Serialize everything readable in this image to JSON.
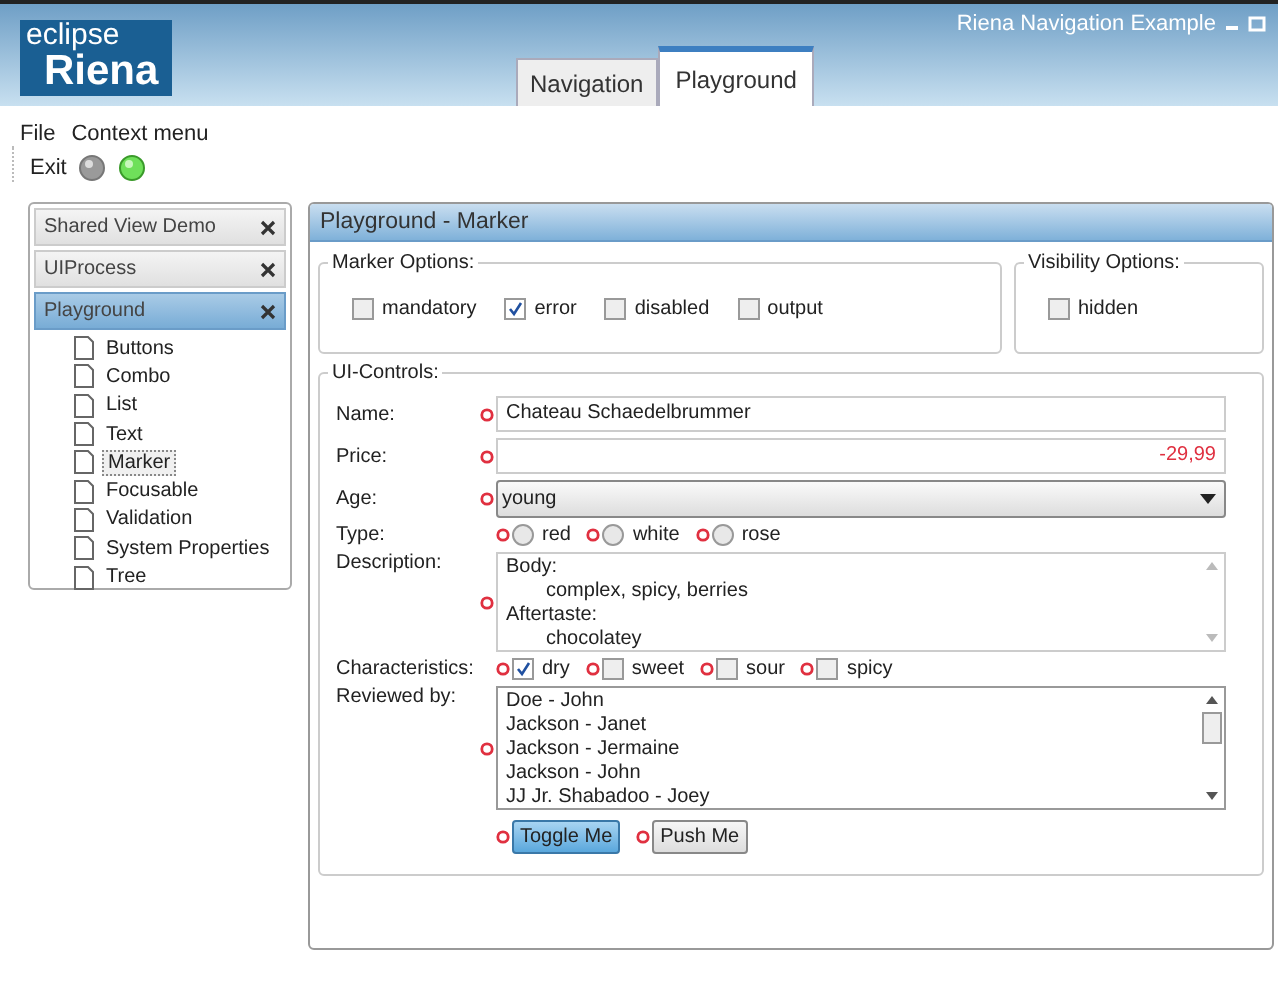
{
  "window": {
    "title": "Riena Navigation Example"
  },
  "logo": {
    "top": "eclipse",
    "bottom": "Riena"
  },
  "tabs": [
    {
      "label": "Navigation",
      "selected": false
    },
    {
      "label": "Playground",
      "selected": true
    }
  ],
  "menu": [
    "File",
    "Context menu"
  ],
  "toolbar": {
    "exit": "Exit"
  },
  "sidebar": {
    "groups": [
      {
        "label": "Shared View Demo",
        "selected": false
      },
      {
        "label": "UIProcess",
        "selected": false
      },
      {
        "label": "Playground",
        "selected": true,
        "children": [
          {
            "label": "Buttons",
            "selected": false
          },
          {
            "label": "Combo",
            "selected": false
          },
          {
            "label": "List",
            "selected": false
          },
          {
            "label": "Text",
            "selected": false
          },
          {
            "label": "Marker",
            "selected": true
          },
          {
            "label": "Focusable",
            "selected": false
          },
          {
            "label": "Validation",
            "selected": false
          },
          {
            "label": "System Properties",
            "selected": false
          },
          {
            "label": "Tree",
            "selected": false
          }
        ]
      }
    ]
  },
  "view": {
    "title": "Playground - Marker",
    "marker_options": {
      "title": "Marker Options:",
      "options": [
        {
          "label": "mandatory",
          "checked": false
        },
        {
          "label": "error",
          "checked": true
        },
        {
          "label": "disabled",
          "checked": false
        },
        {
          "label": "output",
          "checked": false
        }
      ]
    },
    "visibility_options": {
      "title": "Visibility Options:",
      "options": [
        {
          "label": "hidden",
          "checked": false
        }
      ]
    },
    "ui_controls": {
      "title": "UI-Controls:",
      "name": {
        "label": "Name:",
        "value": "Chateau Schaedelbrummer",
        "error": true
      },
      "price": {
        "label": "Price:",
        "value": "-29,99",
        "error": true
      },
      "age": {
        "label": "Age:",
        "value": "young",
        "error": true
      },
      "type": {
        "label": "Type:",
        "options": [
          {
            "label": "red",
            "selected": false,
            "error": true
          },
          {
            "label": "white",
            "selected": false,
            "error": true
          },
          {
            "label": "rose",
            "selected": false,
            "error": true
          }
        ]
      },
      "description": {
        "label": "Description:",
        "error": true,
        "lines": [
          {
            "text": "Body:",
            "kind": "heading"
          },
          {
            "text": "complex, spicy, berries",
            "kind": "detail"
          },
          {
            "text": "Aftertaste:",
            "kind": "heading"
          },
          {
            "text": "chocolatey",
            "kind": "detail"
          }
        ]
      },
      "characteristics": {
        "label": "Characteristics:",
        "options": [
          {
            "label": "dry",
            "checked": true,
            "error": true
          },
          {
            "label": "sweet",
            "checked": false,
            "error": true
          },
          {
            "label": "sour",
            "checked": false,
            "error": true
          },
          {
            "label": "spicy",
            "checked": false,
            "error": true
          }
        ]
      },
      "reviewed_by": {
        "label": "Reviewed by:",
        "error": true,
        "items": [
          "Doe - John",
          "Jackson - Janet",
          "Jackson - Jermaine",
          "Jackson - John",
          "JJ Jr. Shabadoo - Joey"
        ]
      },
      "buttons": [
        {
          "label": "Toggle Me",
          "pressed": true,
          "error": true
        },
        {
          "label": "Push Me",
          "pressed": false,
          "error": true
        }
      ]
    }
  }
}
